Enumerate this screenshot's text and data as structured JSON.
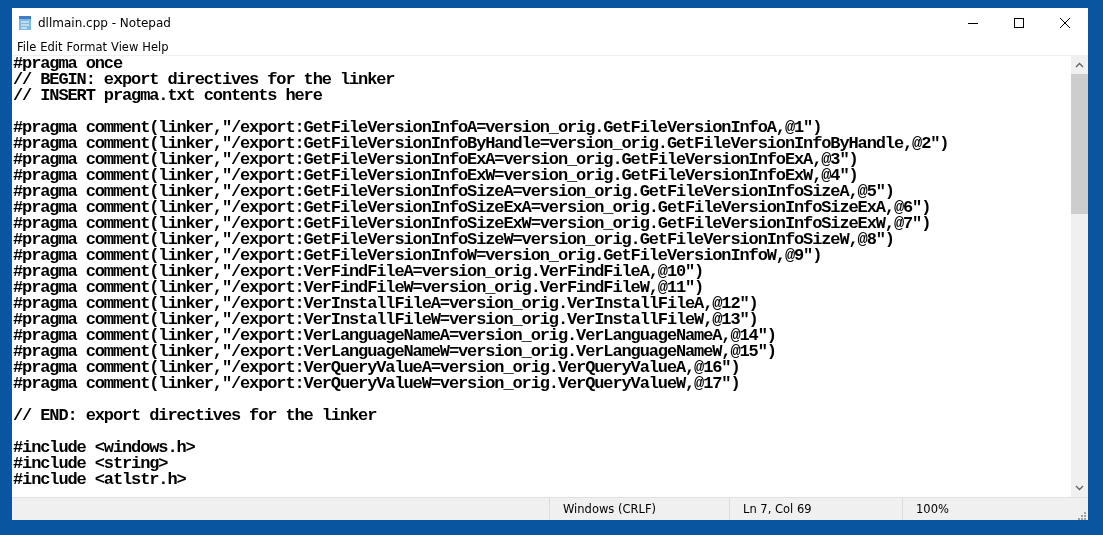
{
  "window": {
    "title": "dllmain.cpp - Notepad"
  },
  "menu": [
    "File",
    "Edit",
    "Format",
    "View",
    "Help"
  ],
  "editor": {
    "blocks": [
      [
        "#pragma once",
        "// BEGIN: export directives for the linker",
        "// INSERT pragma.txt contents here"
      ],
      [
        "#pragma comment(linker,\"/export:GetFileVersionInfoA=version_orig.GetFileVersionInfoA,@1\")",
        "#pragma comment(linker,\"/export:GetFileVersionInfoByHandle=version_orig.GetFileVersionInfoByHandle,@2\")",
        "#pragma comment(linker,\"/export:GetFileVersionInfoExA=version_orig.GetFileVersionInfoExA,@3\")",
        "#pragma comment(linker,\"/export:GetFileVersionInfoExW=version_orig.GetFileVersionInfoExW,@4\")",
        "#pragma comment(linker,\"/export:GetFileVersionInfoSizeA=version_orig.GetFileVersionInfoSizeA,@5\")",
        "#pragma comment(linker,\"/export:GetFileVersionInfoSizeExA=version_orig.GetFileVersionInfoSizeExA,@6\")",
        "#pragma comment(linker,\"/export:GetFileVersionInfoSizeExW=version_orig.GetFileVersionInfoSizeExW,@7\")",
        "#pragma comment(linker,\"/export:GetFileVersionInfoSizeW=version_orig.GetFileVersionInfoSizeW,@8\")",
        "#pragma comment(linker,\"/export:GetFileVersionInfoW=version_orig.GetFileVersionInfoW,@9\")",
        "#pragma comment(linker,\"/export:VerFindFileA=version_orig.VerFindFileA,@10\")",
        "#pragma comment(linker,\"/export:VerFindFileW=version_orig.VerFindFileW,@11\")",
        "#pragma comment(linker,\"/export:VerInstallFileA=version_orig.VerInstallFileA,@12\")",
        "#pragma comment(linker,\"/export:VerInstallFileW=version_orig.VerInstallFileW,@13\")",
        "#pragma comment(linker,\"/export:VerLanguageNameA=version_orig.VerLanguageNameA,@14\")",
        "#pragma comment(linker,\"/export:VerLanguageNameW=version_orig.VerLanguageNameW,@15\")",
        "#pragma comment(linker,\"/export:VerQueryValueA=version_orig.VerQueryValueA,@16\")",
        "#pragma comment(linker,\"/export:VerQueryValueW=version_orig.VerQueryValueW,@17\")"
      ],
      [
        "// END: export directives for the linker"
      ],
      [
        "#include <windows.h>",
        "#include <string>",
        "#include <atlstr.h>"
      ]
    ]
  },
  "status_bar": {
    "line_ending": "Windows (CRLF)",
    "position": "Ln 7, Col 69",
    "zoom": "100%"
  }
}
